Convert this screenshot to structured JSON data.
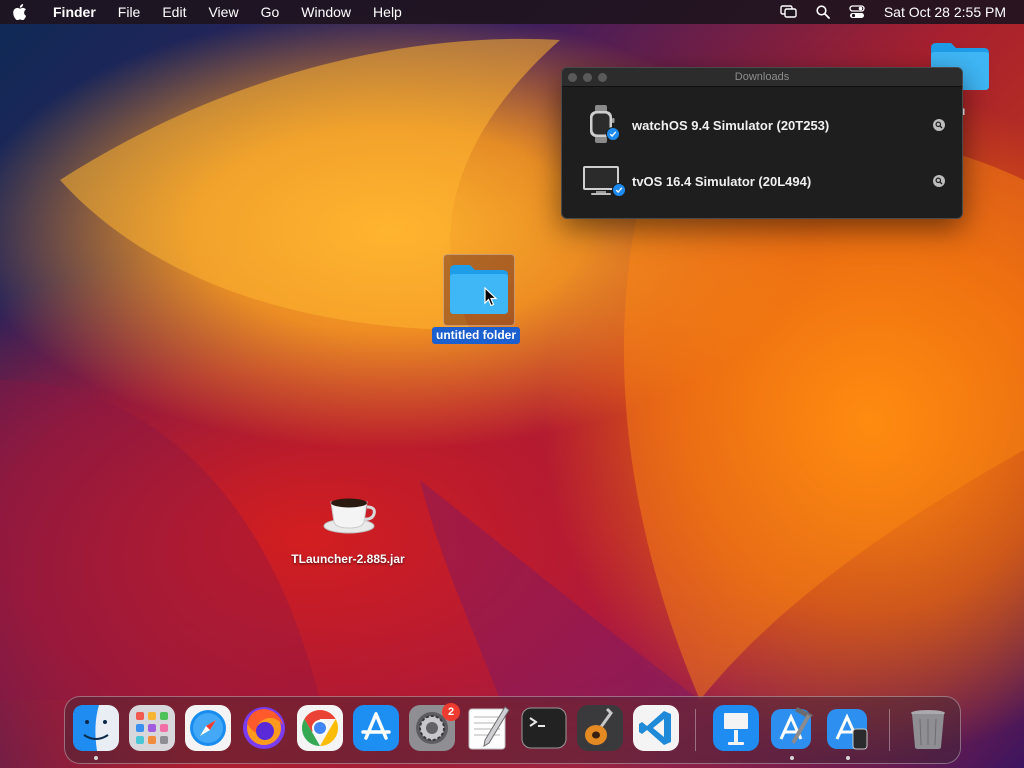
{
  "menubar": {
    "app_name": "Finder",
    "menus": [
      "File",
      "Edit",
      "View",
      "Go",
      "Window",
      "Help"
    ],
    "status_icons": [
      "screen-mirroring-icon",
      "spotlight-search-icon",
      "control-center-icon"
    ],
    "clock": "Sat Oct 28  2:55 PM"
  },
  "downloads_window": {
    "title": "Downloads",
    "items": [
      {
        "name": "watchOS 9.4 Simulator (20T253)",
        "icon": "apple-watch-icon"
      },
      {
        "name": "tvOS 16.4 Simulator (20L494)",
        "icon": "apple-tv-icon"
      }
    ]
  },
  "desktop": {
    "selected_folder_label": "untitled folder",
    "jar_label": "TLauncher-2.885.jar",
    "corner_folder_label_fragment": "u"
  },
  "dock": {
    "apps": [
      {
        "name": "Finder",
        "icon": "finder-icon",
        "running": true
      },
      {
        "name": "Launchpad",
        "icon": "launchpad-icon",
        "running": false
      },
      {
        "name": "Safari",
        "icon": "safari-icon",
        "running": false
      },
      {
        "name": "Firefox",
        "icon": "firefox-icon",
        "running": false
      },
      {
        "name": "Google Chrome",
        "icon": "chrome-icon",
        "running": false
      },
      {
        "name": "App Store",
        "icon": "app-store-icon",
        "running": false
      },
      {
        "name": "System Settings",
        "icon": "system-settings-icon",
        "running": false,
        "badge": "2"
      },
      {
        "name": "TextEdit",
        "icon": "textedit-icon",
        "running": false
      },
      {
        "name": "Terminal",
        "icon": "terminal-icon",
        "running": false
      },
      {
        "name": "GarageBand",
        "icon": "garageband-icon",
        "running": false
      },
      {
        "name": "Visual Studio Code",
        "icon": "vscode-icon",
        "running": false
      },
      {
        "name": "Keynote",
        "icon": "keynote-icon",
        "running": false
      },
      {
        "name": "Xcode",
        "icon": "xcode-icon",
        "running": true
      },
      {
        "name": "Simulator",
        "icon": "simulator-icon",
        "running": true
      },
      {
        "name": "Trash",
        "icon": "trash-icon",
        "running": false
      }
    ]
  }
}
